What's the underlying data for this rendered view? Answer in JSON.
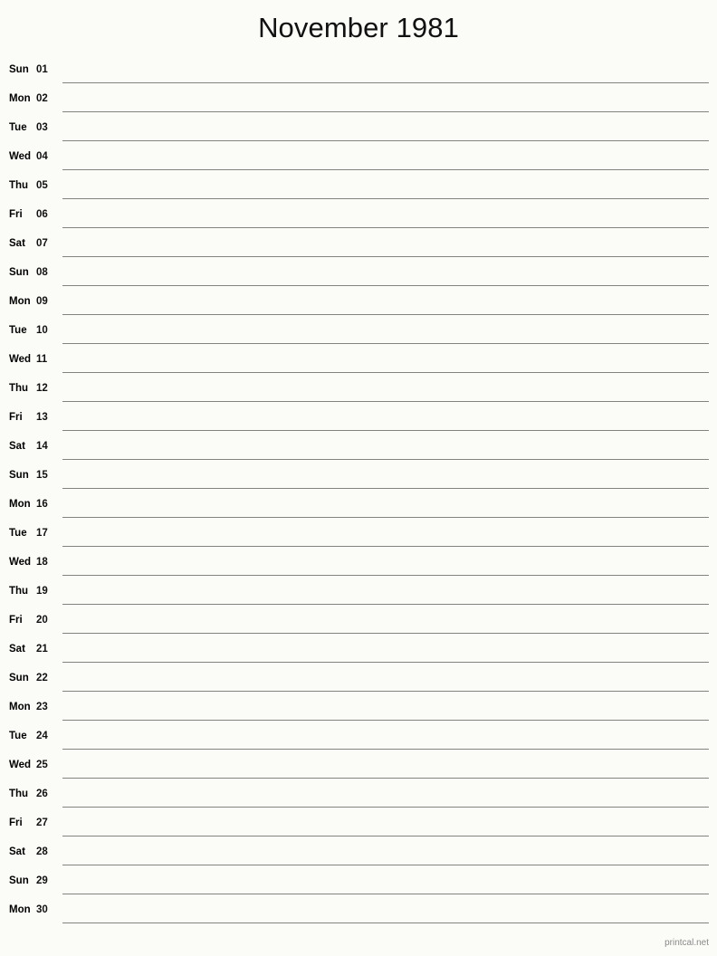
{
  "document": {
    "title": "November 1981",
    "month_name": "November",
    "year": "1981",
    "layout": "notes-lines-single-column",
    "background_color": "#fbfcf7",
    "line_color": "#80847c",
    "text_color": "#000000"
  },
  "footer": {
    "brand": "printcal.net",
    "color": "#8a8a8a"
  },
  "days": [
    {
      "dow": "Sun",
      "dom": "01"
    },
    {
      "dow": "Mon",
      "dom": "02"
    },
    {
      "dow": "Tue",
      "dom": "03"
    },
    {
      "dow": "Wed",
      "dom": "04"
    },
    {
      "dow": "Thu",
      "dom": "05"
    },
    {
      "dow": "Fri",
      "dom": "06"
    },
    {
      "dow": "Sat",
      "dom": "07"
    },
    {
      "dow": "Sun",
      "dom": "08"
    },
    {
      "dow": "Mon",
      "dom": "09"
    },
    {
      "dow": "Tue",
      "dom": "10"
    },
    {
      "dow": "Wed",
      "dom": "11"
    },
    {
      "dow": "Thu",
      "dom": "12"
    },
    {
      "dow": "Fri",
      "dom": "13"
    },
    {
      "dow": "Sat",
      "dom": "14"
    },
    {
      "dow": "Sun",
      "dom": "15"
    },
    {
      "dow": "Mon",
      "dom": "16"
    },
    {
      "dow": "Tue",
      "dom": "17"
    },
    {
      "dow": "Wed",
      "dom": "18"
    },
    {
      "dow": "Thu",
      "dom": "19"
    },
    {
      "dow": "Fri",
      "dom": "20"
    },
    {
      "dow": "Sat",
      "dom": "21"
    },
    {
      "dow": "Sun",
      "dom": "22"
    },
    {
      "dow": "Mon",
      "dom": "23"
    },
    {
      "dow": "Tue",
      "dom": "24"
    },
    {
      "dow": "Wed",
      "dom": "25"
    },
    {
      "dow": "Thu",
      "dom": "26"
    },
    {
      "dow": "Fri",
      "dom": "27"
    },
    {
      "dow": "Sat",
      "dom": "28"
    },
    {
      "dow": "Sun",
      "dom": "29"
    },
    {
      "dow": "Mon",
      "dom": "30"
    }
  ]
}
